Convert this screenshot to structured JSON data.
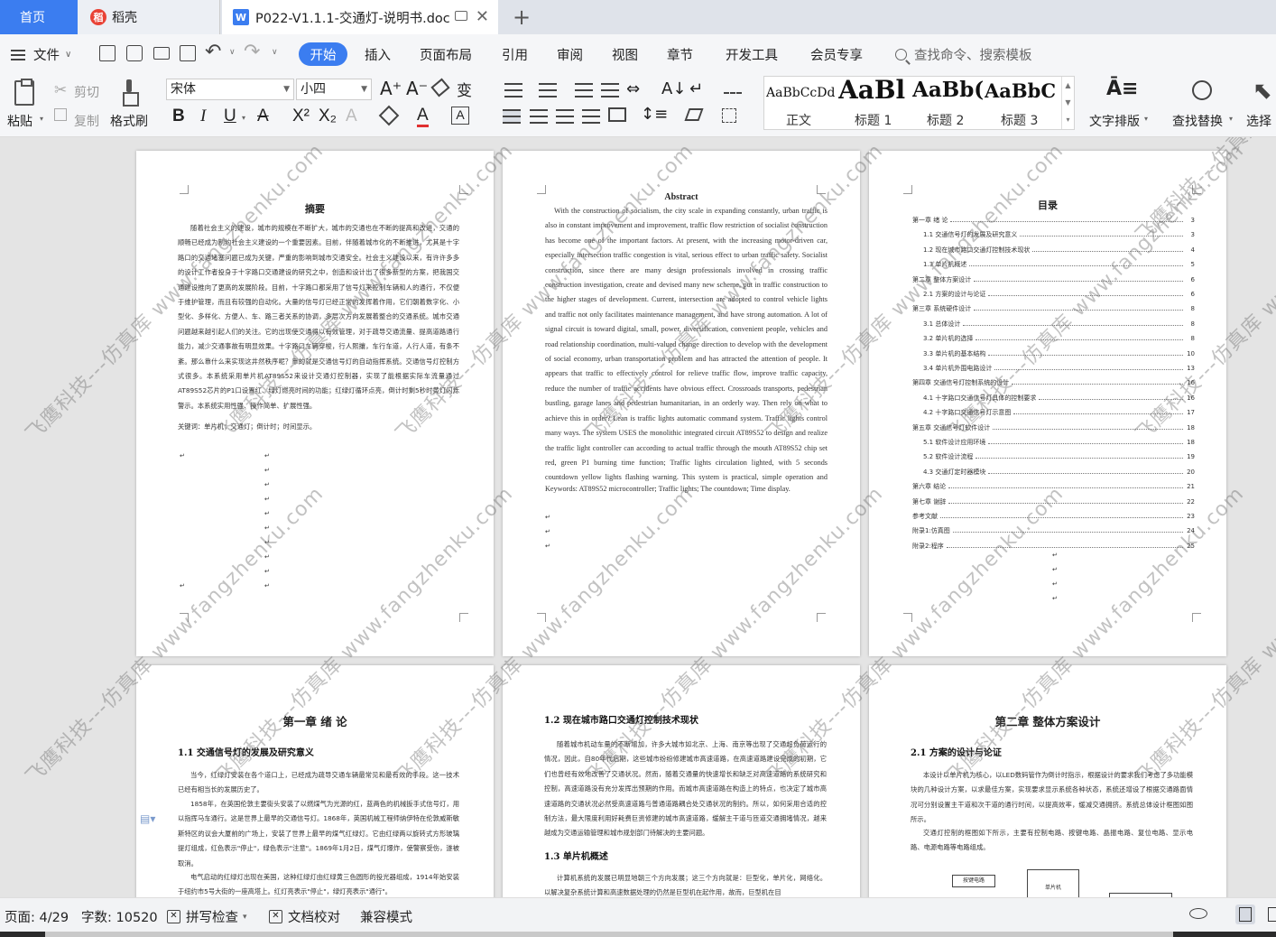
{
  "tabs": {
    "home": "首页",
    "daoke": "稻壳",
    "document": "P022-V1.1.1-交通灯-说明书.doc"
  },
  "menu": {
    "file": "文件",
    "items": [
      "开始",
      "插入",
      "页面布局",
      "引用",
      "审阅",
      "视图",
      "章节",
      "开发工具",
      "会员专享"
    ],
    "search_placeholder": "查找命令、搜索模板"
  },
  "ribbon": {
    "paste": "粘贴",
    "cut": "剪切",
    "copy": "复制",
    "format_painter": "格式刷",
    "font_name": "宋体",
    "font_size": "小四",
    "bold": "B",
    "italic": "I",
    "underline": "U",
    "styles": [
      {
        "preview": "AaBbCcDd",
        "name": "正文"
      },
      {
        "preview": "AaBl",
        "name": "标题 1"
      },
      {
        "preview": "AaBb(",
        "name": "标题 2"
      },
      {
        "preview": "AaBbC",
        "name": "标题 3"
      }
    ],
    "text_layout": "文字排版",
    "find_replace": "查找替换",
    "select": "选择"
  },
  "pages": {
    "p1": {
      "title": "摘要",
      "body": "随着社会主义的建设，城市的规模在不断扩大，城市的交通也在不断的提高和改进，交通的顺畅已经成为制约社会主义建设的一个重要因素。目前，伴随着城市化的不断推进，尤其是十字路口的交通堵塞问题已成为关键，严重的影响到城市交通安全。社会主义建设以来，有许许多多的设计工作者投身于十字路口交通建设的研究之中，创造和设计出了很多新型的方案，把我国交通建设推向了更高的发展阶段。目前，十字路口都采用了信号灯来控制车辆和人的通行，不仅便于维护管理，而且有较强的自动化。大量的信号灯已经正常的发挥着作用，它们朝着数字化、小型化、多样化、方便人、车、路三者关系的协调，多层次方向发展着整合的交通系统。城市交通问题越来越引起人们的关注。它的出现使交通得以有效管理，对于疏导交通流量、提高道路通行能力，减少交通事故有明显效果。十字路口车辆穿梭，行人熙攘，车行车道，人行人道，有条不紊。那么靠什么来实现这井然秩序呢？靠的就是交通信号灯的自动指挥系统。交通信号灯控制方式很多。本系统采用单片机AT89S52来设计交通灯控制器，实现了能根据实际车流量通过AT89S52芯片的P1口设置红、绿灯燃亮时间的功能；红绿灯循环点亮，倒计时剩5秒时黄灯闪烁警示。本系统实用性强、操作简单、扩展性强。",
      "keywords": "关键词：单片机；交通灯；倒计时；时间显示。"
    },
    "p2": {
      "title": "Abstract",
      "body": "With the construction of socialism, the city scale in expanding constantly, urban traffic is also in constant improvement and improvement, traffic flow restriction of socialist construction has become one of the important factors. At present, with the increasing motor-driven car, especially intersection traffic congestion is vital, serious effect to urban traffic safety. Socialist construction, since there are many design professionals involved in crossing traffic construction investigation, create and devised many new scheme, put in traffic construction to the higher stages of development. Current, intersection are adopted to control vehicle lights and traffic not only facilitates maintenance management, and have strong automation. A lot of signal circuit is toward digital, small, power, diversification, convenient people, vehicles and road relationship coordination, multi-valued change direction to develop with the development of social economy, urban transportation problem and has attracted the attention of people. It appears that traffic to effectively control for relieve traffic flow, improve traffic capacity, reduce the number of traffic accidents have obvious effect. Crossroads transports, pedestrian bustling, garage lanes and pedestrian humanitarian, in an orderly way. Then rely on what to achieve this in order? Lean is traffic lights automatic command system. Traffic lights control many ways. The system USES the monolithic integrated circuit AT89S52 to design and realize the traffic light controller can according to actual traffic through the mouth AT89S52 chip set red, green P1 burning time function; Traffic lights circulation lighted, with 5 seconds countdown yellow lights flashing warning. This system is practical, simple operation and function expansion is strong.",
      "keywords": "Keywords: AT89S52 microcontroller; Traffic lights; The countdown; Time display."
    },
    "p3": {
      "title": "目录",
      "toc": [
        {
          "text": "第一章  绪  论",
          "page": "3",
          "indent": 0
        },
        {
          "text": "1.1 交通信号灯的发展及研究意义",
          "page": "3",
          "indent": 1
        },
        {
          "text": "1.2 现在城市路口交通灯控制技术现状",
          "page": "4",
          "indent": 1
        },
        {
          "text": "1.3 单片机概述",
          "page": "5",
          "indent": 1
        },
        {
          "text": "第二章  整体方案设计",
          "page": "6",
          "indent": 0
        },
        {
          "text": "2.1 方案的设计与论证",
          "page": "6",
          "indent": 1
        },
        {
          "text": "第三章  系统硬件设计",
          "page": "8",
          "indent": 0
        },
        {
          "text": "3.1 总体设计",
          "page": "8",
          "indent": 1
        },
        {
          "text": "3.2 单片机的选择",
          "page": "8",
          "indent": 1
        },
        {
          "text": "3.3 单片机的基本结构",
          "page": "10",
          "indent": 1
        },
        {
          "text": "3.4 单片机外围电路设计",
          "page": "13",
          "indent": 1
        },
        {
          "text": "第四章  交通信号灯控制系统的设计",
          "page": "16",
          "indent": 0
        },
        {
          "text": "4.1 十字路口交通信号灯具体的控制要求",
          "page": "16",
          "indent": 1
        },
        {
          "text": "4.2 十字路口交通信号灯示意图",
          "page": "17",
          "indent": 1
        },
        {
          "text": "第五章  交通信号灯软件设计",
          "page": "18",
          "indent": 0
        },
        {
          "text": "5.1 软件设计应用环境",
          "page": "18",
          "indent": 1
        },
        {
          "text": "5.2 软件设计流程",
          "page": "19",
          "indent": 1
        },
        {
          "text": "4.3 交通灯定时器模块",
          "page": "20",
          "indent": 1
        },
        {
          "text": "第六章  结论",
          "page": "21",
          "indent": 0
        },
        {
          "text": "第七章  谢辞",
          "page": "22",
          "indent": 0
        },
        {
          "text": "参考文献",
          "page": "23",
          "indent": 0
        },
        {
          "text": "附录1:仿真图",
          "page": "24",
          "indent": 0
        },
        {
          "text": "附录2:程序",
          "page": "25",
          "indent": 0
        }
      ]
    },
    "p4": {
      "title": "第一章  绪  论",
      "h2": "1.1 交通信号灯的发展及研究意义",
      "paras": [
        "当今，红绿灯安装在各个道口上，已经成为疏导交通车辆最常见和最有效的手段。这一技术已经有相当长的发展历史了。",
        "1858年，在英国伦敦主要街头安装了以燃煤气为光源的红，蓝两色的机械扳手式信号灯，用以指挥马车通行。这是世界上最早的交通信号灯。1868年，英国机械工程师纳伊特在伦敦威斯敏斯特区的议会大厦前的广场上，安装了世界上最早的煤气红绿灯。它由红绿两以旋转式方形玻璃提灯组成，红色表示\"停止\"，绿色表示\"注意\"。1869年1月2日，煤气灯爆炸，使警察受伤，遂被取消。",
        "电气启动的红绿灯出现在美国，这种红绿灯由红绿黄三色圆形的投光器组成，1914年始安装于纽约市5号大街的一座高塔上。红灯亮表示\"停止\"，绿灯亮表示\"通行\"。"
      ]
    },
    "p5": {
      "h2a": "1.2 现在城市路口交通灯控制技术现状",
      "para1": "随着城市机动车量的不断增加，许多大城市如北京、上海、南京等出现了交通超负荷运行的情况，因此，自80年代后期，这些城市纷纷修建城市高速道路，在高速道路建设完成的初期，它们也曾经有效地改善了交通状况。然而，随着交通量的快速增长和缺乏对高速道路的系统研究和控制，高速道路没有充分发挥出预期的作用。而城市高速道路在构造上的特点，也决定了城市高速道路的交通状况必然受高速道路与普通道路耦合处交通状况的制约。所以，如何采用合适的控制方法，最大限度利用好耗费巨资修建的城市高速道路，缓解主干道与匝道交通拥堵情况，越来越成为交通运输管理和城市规划部门待解决的主要问题。",
      "h2b": "1.3 单片机概述",
      "para2": "计算机系统的发展已明显地朝三个方向发展；这三个方向就是：巨型化，单片化，网络化。以解决复杂系统计算和高速数据处理的仍然是巨型机在起作用，故而，巨型机在目"
    },
    "p6": {
      "title": "第二章  整体方案设计",
      "h2": "2.1 方案的设计与论证",
      "para1": "本设计以单片机为核心，以LED数码管作为倒计时指示，根据设计的要求我们考虑了多功能模块的几种设计方案，以求最佳方案，实现要求显示系统各种状态，系统还增设了根据交通路面情况可分别设置主干道和次干道的通行时间，以提高效率，缓减交通拥挤。系统总体设计框图如图所示。",
      "para2": "交通灯控制的框图如下所示，主要有控制电路、按键电路、晶振电路、复位电路、显示电路、电源电路等电路组成。",
      "box1": "按键电路",
      "box2": "单片机"
    }
  },
  "status": {
    "page": "页面: 4/29",
    "words": "字数: 10520",
    "spell": "拼写检查",
    "proof": "文档校对",
    "compat": "兼容模式"
  },
  "watermark": "飞鹰科技---仿真库 www.fangzhenku.com"
}
